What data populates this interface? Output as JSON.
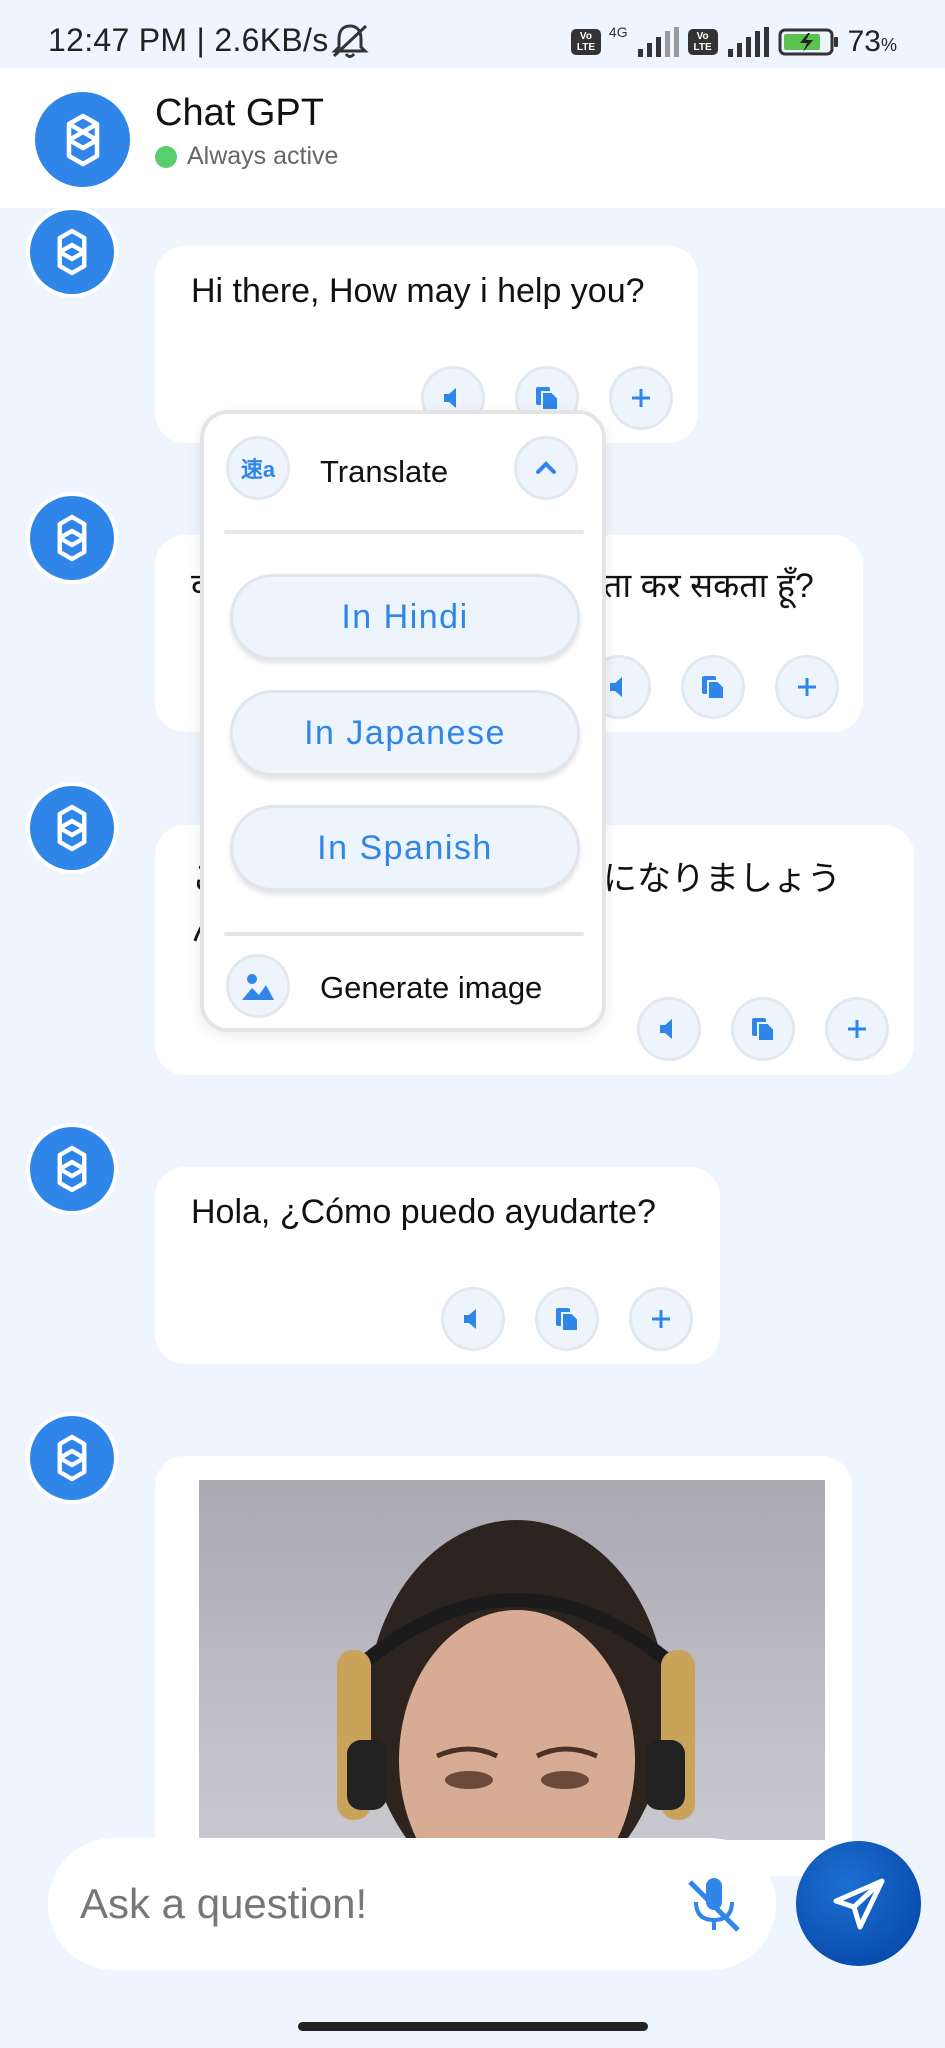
{
  "status_bar": {
    "time": "12:47 PM | 2.6KB/s",
    "volte_label": "Vo LTE",
    "net_type": "4G",
    "battery": "73",
    "battery_unit": "%"
  },
  "header": {
    "title": "Chat GPT",
    "status": "Always active",
    "avatar_icon": "openai-logo-icon"
  },
  "messages": [
    {
      "text": "Hi there, How may i help you?"
    },
    {
      "text_left": "क",
      "text_right": "ता कर सकता हूँ?"
    },
    {
      "text_left": "こ",
      "text_left2": "ん",
      "text_right": "になりましょう"
    },
    {
      "text": "Hola, ¿Cómo puedo ayudarte?"
    },
    {
      "type": "image",
      "alt": "generated image"
    }
  ],
  "actions": {
    "speak_icon": "speaker-icon",
    "copy_icon": "copy-icon",
    "more_icon": "plus-icon"
  },
  "popup": {
    "translate_label": "Translate",
    "translate_icon_text": "速a",
    "languages": [
      "In Hindi",
      "In Japanese",
      "In Spanish"
    ],
    "generate_label": "Generate image"
  },
  "input": {
    "placeholder": "Ask a question!"
  },
  "colors": {
    "accent": "#2f86e8",
    "background": "#eef5fe",
    "send": "#0a4fb0"
  }
}
